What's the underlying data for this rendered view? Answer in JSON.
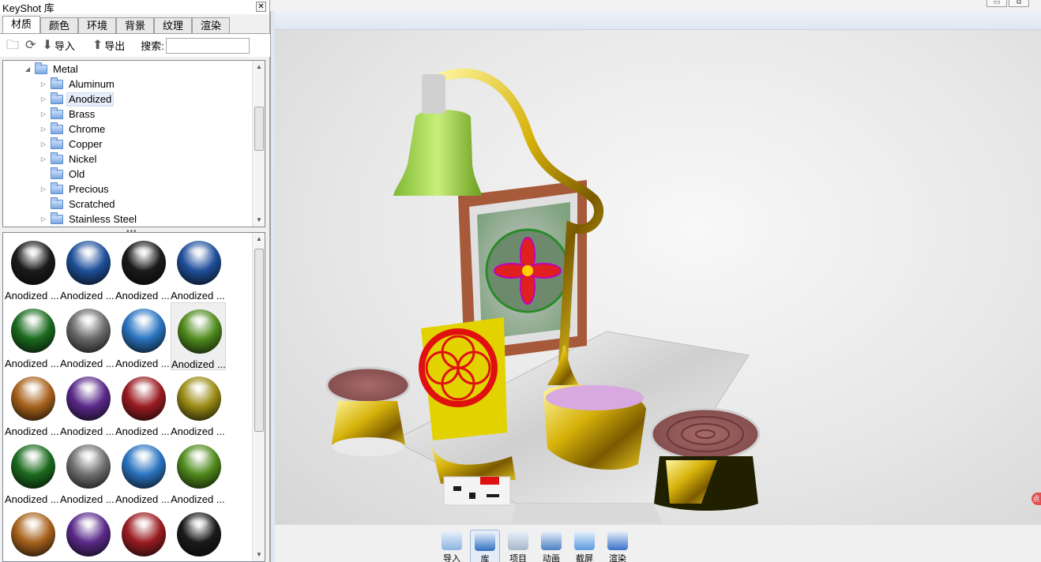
{
  "library": {
    "title": "KeyShot 库",
    "tabs": [
      {
        "label": "材质",
        "active": true
      },
      {
        "label": "颜色",
        "active": false
      },
      {
        "label": "环境",
        "active": false
      },
      {
        "label": "背景",
        "active": false
      },
      {
        "label": "纹理",
        "active": false
      },
      {
        "label": "渲染",
        "active": false
      }
    ],
    "toolbar": {
      "import_label": "导入",
      "export_label": "导出",
      "search_label": "搜索:",
      "search_value": ""
    },
    "tree": {
      "root": "Metal",
      "items": [
        {
          "label": "Aluminum",
          "expandable": true,
          "selected": false
        },
        {
          "label": "Anodized",
          "expandable": true,
          "selected": true
        },
        {
          "label": "Brass",
          "expandable": true,
          "selected": false
        },
        {
          "label": "Chrome",
          "expandable": true,
          "selected": false
        },
        {
          "label": "Copper",
          "expandable": true,
          "selected": false
        },
        {
          "label": "Nickel",
          "expandable": true,
          "selected": false
        },
        {
          "label": "Old",
          "expandable": false,
          "selected": false
        },
        {
          "label": "Precious",
          "expandable": true,
          "selected": false
        },
        {
          "label": "Scratched",
          "expandable": false,
          "selected": false
        },
        {
          "label": "Stainless Steel",
          "expandable": true,
          "selected": false
        }
      ]
    },
    "materials": [
      {
        "label": "Anodized ...",
        "color": "#1a1a1a"
      },
      {
        "label": "Anodized ...",
        "color": "#1f4f9a"
      },
      {
        "label": "Anodized ...",
        "color": "#1a1a1a"
      },
      {
        "label": "Anodized ...",
        "color": "#1f4f9a"
      },
      {
        "label": "Anodized ...",
        "color": "#1b6b1e"
      },
      {
        "label": "Anodized ...",
        "color": "#6a6a6a"
      },
      {
        "label": "Anodized ...",
        "color": "#2a74c0"
      },
      {
        "label": "Anodized ...",
        "color": "#4f8a1c"
      },
      {
        "label": "Anodized ...",
        "color": "#a8621c"
      },
      {
        "label": "Anodized ...",
        "color": "#5a2a8a"
      },
      {
        "label": "Anodized ...",
        "color": "#9a1c22"
      },
      {
        "label": "Anodized ...",
        "color": "#9a8a14"
      },
      {
        "label": "Anodized ...",
        "color": "#1b6b1e"
      },
      {
        "label": "Anodized ...",
        "color": "#707070"
      },
      {
        "label": "Anodized ...",
        "color": "#2a74c0"
      },
      {
        "label": "Anodized ...",
        "color": "#4f8a1c"
      },
      {
        "label": "",
        "color": "#a8621c"
      },
      {
        "label": "",
        "color": "#5a2a8a"
      },
      {
        "label": "",
        "color": "#9a1c22"
      },
      {
        "label": "",
        "color": "#1a1a1a"
      }
    ]
  },
  "bottombar": {
    "items": [
      {
        "label": "导入",
        "icon": "import-icon",
        "active": false
      },
      {
        "label": "库",
        "icon": "library-icon",
        "active": true
      },
      {
        "label": "项目",
        "icon": "project-icon",
        "active": false
      },
      {
        "label": "动画",
        "icon": "animation-icon",
        "active": false
      },
      {
        "label": "截屏",
        "icon": "screenshot-icon",
        "active": false
      },
      {
        "label": "渲染",
        "icon": "render-icon",
        "active": false
      }
    ]
  }
}
